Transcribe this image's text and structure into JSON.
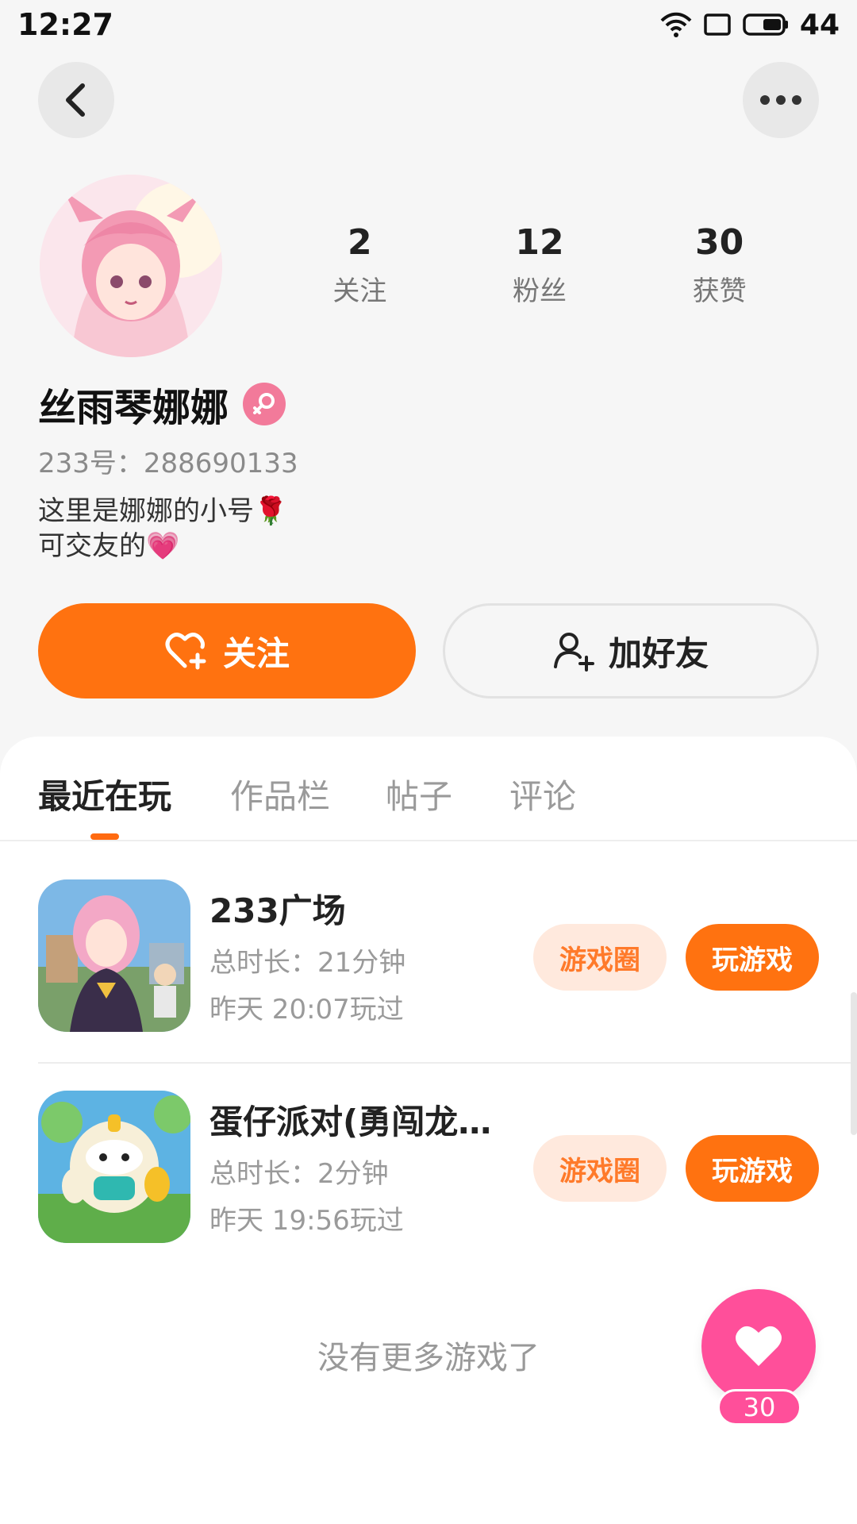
{
  "status_bar": {
    "time": "12:27",
    "battery": "44"
  },
  "profile": {
    "name": "丝雨琴娜娜",
    "id_line": "233号：288690133",
    "bio": [
      "这里是娜娜的小号🌹",
      "可交友的💗"
    ]
  },
  "stats": [
    {
      "value": "2",
      "label": "关注"
    },
    {
      "value": "12",
      "label": "粉丝"
    },
    {
      "value": "30",
      "label": "获赞"
    }
  ],
  "actions": {
    "follow": "关注",
    "add_friend": "加好友"
  },
  "tabs": [
    "最近在玩",
    "作品栏",
    "帖子",
    "评论"
  ],
  "games": [
    {
      "title": "233广场",
      "duration": "总时长：21分钟",
      "last_played": "昨天 20:07玩过",
      "circle_btn": "游戏圈",
      "play_btn": "玩游戏"
    },
    {
      "title": "蛋仔派对(勇闯龙蛋…",
      "duration": "总时长：2分钟",
      "last_played": "昨天 19:56玩过",
      "circle_btn": "游戏圈",
      "play_btn": "玩游戏"
    }
  ],
  "empty_text": "没有更多游戏了",
  "like_count": "30",
  "colors": {
    "accent": "#ff7210",
    "like": "#ff4f9a",
    "badge": "#f27a9a"
  }
}
